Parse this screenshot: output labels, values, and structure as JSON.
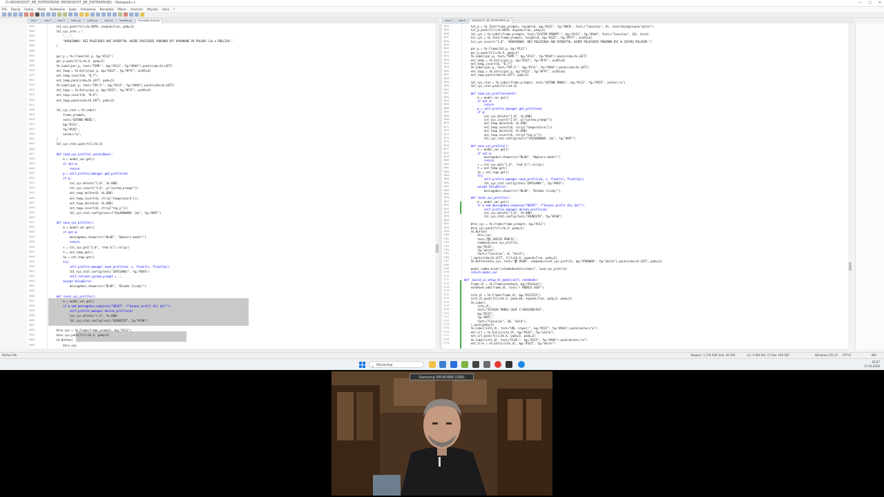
{
  "window": {
    "title": "D:\\MONOIDOT_BE_ENTERPRISE (MONOIDOT_BE_ENTERPRISE) - Notepad++",
    "controls": [
      "—",
      "□",
      "✕"
    ]
  },
  "menu": [
    "Plik",
    "Edycja",
    "Szukaj",
    "Widok",
    "Kodowanie",
    "Język",
    "Ustawienia",
    "Narzędzia",
    "Makra",
    "Uruchom",
    "Wtyczki",
    "Okna",
    "?"
  ],
  "left_tabs": [
    "new 1",
    "new 2",
    "new 3",
    "main.py",
    "config.py",
    "utils.py",
    "models.py",
    "monoidot_final.py"
  ],
  "right_tabs": [
    "new 4",
    "new 5",
    "MONOIDOT_BE_ENTERPRISE.py"
  ],
  "left_code": [
    {
      "n": "3601",
      "t": "    txt_sys.pack(fill=tk.BOTH, expand=True, pady=5)"
    },
    {
      "n": "3602",
      "t": "    lbl_sys_info = ("
    },
    {
      "n": "3603",
      "t": "        \"...\","
    },
    {
      "n": "3604",
      "t": "        \"WSKAZOWKA: BEZ POLECENIA ANI DYREKTYW, KAZDE POLECENIE POWINNO BYC WYKONANE PO POLSKU lub w ENGLISH.\""
    },
    {
      "n": "3605",
      "t": "    )"
    },
    {
      "n": "3606",
      "t": ""
    },
    {
      "n": "3607",
      "t": "    par_p = tk.Frame(lbl_p, bg=\"#111\")"
    },
    {
      "n": "3608",
      "t": "    par_p.pack(fill=tk.X, pady=5)"
    },
    {
      "n": "3609",
      "t": "    tk.Label(par_p, text=\"TEMP:\", bg=\"#111\", fg=\"#AAA\").pack(side=tk.LEFT)"
    },
    {
      "n": "3610",
      "t": "    ent_temp = tk.Entry(par_p, bg=\"#222\", fg=\"#FFF\", width=6)"
    },
    {
      "n": "3611",
      "t": "    ent_temp.insert(0, \"0.7\")"
    },
    {
      "n": "3612",
      "t": "    ent_temp.pack(side=tk.LEFT, padx=5)"
    },
    {
      "n": "3613",
      "t": "    tk.Label(par_p, text=\"TOP_P:\", bg=\"#111\", fg=\"#AAA\").pack(side=tk.LEFT)"
    },
    {
      "n": "3614",
      "t": "    ent_topp = tk.Entry(par_p, bg=\"#222\", fg=\"#FFF\", width=6)"
    },
    {
      "n": "3615",
      "t": "    ent_topp.insert(0, \"0.9\")"
    },
    {
      "n": "3616",
      "t": "    ent_topp.pack(side=tk.LEFT, padx=5)"
    },
    {
      "n": "3617",
      "t": ""
    },
    {
      "n": "3618",
      "t": "    lbl_sys_stat = tk.Label("
    },
    {
      "n": "3619",
      "t": "        frame_prompts,"
    },
    {
      "n": "3620",
      "t": "        text=\"GOTOWE MODEL\","
    },
    {
      "n": "3621",
      "t": "        bg=\"#111\","
    },
    {
      "n": "3622",
      "t": "        fg=\"#555\","
    },
    {
      "n": "3623",
      "t": "        anchor=\"w\","
    },
    {
      "n": "3624",
      "t": "    )"
    },
    {
      "n": "3625",
      "t": "    lbl_sys_stat.pack(fill=tk.X)"
    },
    {
      "n": "3626",
      "t": ""
    },
    {
      "n": "3627",
      "t": "    def load_sys_profile(_event=None):"
    },
    {
      "n": "3628",
      "t": "        m = model_var.get()"
    },
    {
      "n": "3629",
      "t": "        if not m:"
    },
    {
      "n": "3630",
      "t": "            return"
    },
    {
      "n": "3631",
      "t": "        p = self.profile_manager.get_profile(m)"
    },
    {
      "n": "3632",
      "t": "        if p:"
    },
    {
      "n": "3633",
      "t": "            txt_sys.delete(\"1.0\", tk.END)"
    },
    {
      "n": "3634",
      "t": "            txt_sys.insert(\"1.0\", p[\"system_prompt\"])"
    },
    {
      "n": "3635",
      "t": "            ent_temp.delete(0, tk.END)"
    },
    {
      "n": "3636",
      "t": "            ent_temp.insert(0, str(p[\"temperature\"]))"
    },
    {
      "n": "3637",
      "t": "            ent_topp.delete(0, tk.END)"
    },
    {
      "n": "3638",
      "t": "            ent_topp.insert(0, str(p[\"top_p\"]))"
    },
    {
      "n": "3639",
      "t": "            lbl_sys_stat.config(text=f\"ZALADOWANO: {m}\", fg=\"#0FF\")"
    },
    {
      "n": "3640",
      "t": ""
    },
    {
      "n": "3641",
      "t": "    def save_sys_profile():"
    },
    {
      "n": "3642",
      "t": "        m = model_var.get()"
    },
    {
      "n": "3643",
      "t": "        if not m:"
    },
    {
      "n": "3644",
      "t": "            messagebox.showerror(\"BLAD\", \"Wybierz model!\")"
    },
    {
      "n": "3645",
      "t": "            return"
    },
    {
      "n": "3646",
      "t": "        s = txt_sys.get(\"1.0\", \"end-1c\").strip()"
    },
    {
      "n": "3647",
      "t": "        t = ent_temp.get()"
    },
    {
      "n": "3648",
      "t": "        tp = ent_topp.get()"
    },
    {
      "n": "3649",
      "t": "        try:"
    },
    {
      "n": "3650",
      "t": "            self.profile_manager.save_profile(m, s, float(t), float(tp))"
    },
    {
      "n": "3651",
      "t": "            lbl_sys_stat.config(text=\"ZAPISANO!\", fg=\"#0F0\")"
    },
    {
      "n": "3652",
      "t": "            self.refresh_system_prompt = ..."
    },
    {
      "n": "3653",
      "t": "        except ValueError:"
    },
    {
      "n": "3654",
      "t": "            messagebox.showerror(\"BLAD\", \"Bledne liczby!\")"
    },
    {
      "n": "3655",
      "t": ""
    },
    {
      "n": "3656",
      "t": "    def reset_sys_profile():"
    },
    {
      "n": "3657",
      "t": "        m = model_var.get()"
    },
    {
      "n": "3658",
      "t": "        if m and messagebox.askyesno(\"RESET\", f\"Usunac profil dla {m}?\"):"
    },
    {
      "n": "3659",
      "t": "            self.profile_manager.delete_profile(m)"
    },
    {
      "n": "3660",
      "t": "            txt_sys.delete(\"1.0\", tk.END)"
    },
    {
      "n": "3661",
      "t": "            lbl_sys_stat.config(text=\"USUNIETO\", fg=\"#F00\")"
    },
    {
      "n": "3662",
      "t": ""
    },
    {
      "n": "3663",
      "t": "    btns_sys = tk.Frame(frame_prompts, bg=\"#111\")"
    },
    {
      "n": "3664",
      "t": "    btns_sys.pack(fill=tk.X, pady=5)"
    },
    {
      "n": "3665",
      "t": "    tk.Button("
    },
    {
      "n": "3666",
      "t": "        btns_sys,"
    }
  ],
  "right_code": [
    {
      "n": "3644",
      "t": "    txt_p = tk.Text(frame_prompts, height=6, bg=\"#222\", fg=\"#0F0\", font=(\"Consolas\", 9), insertbackground=\"white\")"
    },
    {
      "n": "3645",
      "t": "    txt_p.pack(fill=tk.BOTH, expand=True, pady=5)"
    },
    {
      "n": "3646",
      "t": "    lbl_sys = tk.Label(frame_prompts, text=\"SYSTEM PROMPT:\", bg=\"#111\", fg=\"#AAA\", font=(\"Consolas\", 10), bold)"
    },
    {
      "n": "3647",
      "t": "    txt_sys = tk.Text(frame_prompts, height=6, bg=\"#222\", fg=\"#FFF\", width=6)"
    },
    {
      "n": "3648",
      "t": "    txt_sys.insert(\"1.0\", \"WSKAZOWKA: BEZ POLECENIA ANI DYREKTYW, KAZDE POLECENIE POWINNO BYC W JEZYKU POLSKIM.\")"
    },
    {
      "n": "3649",
      "t": ""
    },
    {
      "n": "3650",
      "t": "    par_p = tk.Frame(lbl_p, bg=\"#111\")"
    },
    {
      "n": "3651",
      "t": "    par_p.pack(fill=tk.X, pady=5)"
    },
    {
      "n": "3652",
      "t": "    tk.Label(par_p, text=\"TEMP:\", bg=\"#111\", fg=\"#AAA\").pack(side=tk.LEFT)"
    },
    {
      "n": "3653",
      "t": "    ent_temp = tk.Entry(par_p, bg=\"#222\", fg=\"#FFF\", width=6)"
    },
    {
      "n": "3654",
      "t": "    ent_temp.insert(0, \"0.7\")"
    },
    {
      "n": "3655",
      "t": "    tk.Label(par_p, text=\"TOP_P:\", bg=\"#111\", fg=\"#AAA\").pack(side=tk.LEFT)"
    },
    {
      "n": "3656",
      "t": "    ent_topp = tk.Entry(par_p, bg=\"#222\", fg=\"#FFF\", width=6)"
    },
    {
      "n": "3657",
      "t": "    ent_topp.pack(side=tk.LEFT, padx=5)"
    },
    {
      "n": "3658",
      "t": ""
    },
    {
      "n": "3659",
      "t": "    lbl_sys_stat = tk.Label(frame_prompts, text=\"GOTOWE MODEL\", bg=\"#111\", fg=\"#555\", anchor=\"w\")"
    },
    {
      "n": "3660",
      "t": "    lbl_sys_stat.pack(fill=tk.X)"
    },
    {
      "n": "3661",
      "t": ""
    },
    {
      "n": "3662",
      "t": "    def load_sys_profile(event):"
    },
    {
      "n": "3663",
      "t": "        m = model_var.get()"
    },
    {
      "n": "3664",
      "t": "        if not m:"
    },
    {
      "n": "3665",
      "t": "            return"
    },
    {
      "n": "3666",
      "t": "        p = self.profile_manager.get_profile(m)"
    },
    {
      "n": "3667",
      "t": "        if p:"
    },
    {
      "n": "3668",
      "t": "            txt_sys.delete(\"1.0\", tk.END)"
    },
    {
      "n": "3669",
      "t": "            txt_sys.insert(\"1.0\", p[\"system_prompt\"])"
    },
    {
      "n": "3670",
      "t": "            ent_temp.delete(0, tk.END)"
    },
    {
      "n": "3671",
      "t": "            ent_temp.insert(0, str(p[\"temperature\"]))"
    },
    {
      "n": "3672",
      "t": "            ent_topp.delete(0, tk.END)"
    },
    {
      "n": "3673",
      "t": "            ent_topp.insert(0, str(p[\"top_p\"]))"
    },
    {
      "n": "3674",
      "t": "            lbl_sys_stat.config(text=f\"ZALADOWANO: {m}\", fg=\"#0FF\")"
    },
    {
      "n": "3675",
      "t": ""
    },
    {
      "n": "3676",
      "t": "    def save_sys_profile():"
    },
    {
      "n": "3677",
      "t": "        m = model_var.get()"
    },
    {
      "n": "3678",
      "t": "        if not m:"
    },
    {
      "n": "3679",
      "t": "            messagebox.showerror(\"BLAD\", \"Wybierz model!\")"
    },
    {
      "n": "3680",
      "t": "            return"
    },
    {
      "n": "3681",
      "t": "        s = txt_sys.get(\"1.0\", \"end-1c\").strip()"
    },
    {
      "n": "3682",
      "t": "        t = ent_temp.get()"
    },
    {
      "n": "3683",
      "t": "        tp = ent_topp.get()"
    },
    {
      "n": "3684",
      "t": "        try:"
    },
    {
      "n": "3685",
      "t": "            self.profile_manager.save_profile(m, s, float(t), float(tp))"
    },
    {
      "n": "3686",
      "t": "            lbl_sys_stat.config(text=\"ZAPISANO!\", fg=\"#0F0\")"
    },
    {
      "n": "3687",
      "t": "        except ValueError:"
    },
    {
      "n": "3688",
      "t": "            messagebox.showerror(\"BLAD\", \"Bledne liczby!\")"
    },
    {
      "n": "3689",
      "t": ""
    },
    {
      "n": "3690",
      "t": "    def reset_sys_profile():"
    },
    {
      "n": "3691",
      "t": "        m = model_var.get()"
    },
    {
      "n": "3692",
      "t": "        if m and messagebox.askyesno(\"RESET\", f\"Usunac profil dla {m}?\"):"
    },
    {
      "n": "3693",
      "t": "            self.profile_manager.delete_profile(m)"
    },
    {
      "n": "3694",
      "t": "            txt_sys.delete(\"1.0\", tk.END)"
    },
    {
      "n": "3695",
      "t": "            lbl_sys_stat.config(text=\"USUNIETO\", fg=\"#F00\")"
    },
    {
      "n": "3696",
      "t": ""
    },
    {
      "n": "3697",
      "t": "    btns_sys = tk.Frame(frame_prompts, bg=\"#111\")"
    },
    {
      "n": "3698",
      "t": "    btns_sys.pack(fill=tk.X, pady=5)"
    },
    {
      "n": "3699",
      "t": "    tk.Button("
    },
    {
      "n": "3700",
      "t": "        btns_sys,"
    },
    {
      "n": "3701",
      "t": "        text=\"💾 ZAPISZ PROFIL\","
    },
    {
      "n": "3702",
      "t": "        command=save_sys_profile,"
    },
    {
      "n": "3703",
      "t": "        bg=\"#333\","
    },
    {
      "n": "3704",
      "t": "        fg=\"white\","
    },
    {
      "n": "3705",
      "t": "        font=(\"Consolas\", 8, \"bold\"),"
    },
    {
      "n": "3706",
      "t": "    ).pack(side=tk.LEFT, fill=tk.X, expand=True, padx=2)"
    },
    {
      "n": "3707",
      "t": "    tk.Button(btns_sys, text=\"🗑 USUN\", command=reset_sys_profile, bg=\"#500000\", fg=\"white\").pack(side=tk.LEFT, padx=2)"
    },
    {
      "n": "3708",
      "t": ""
    },
    {
      "n": "3709",
      "t": "    model_combo.bind(\"<<ComboboxSelected>>\", load_sys_profile)"
    },
    {
      "n": "3710",
      "t": "    return model_var"
    },
    {
      "n": "3711",
      "t": ""
    },
    {
      "n": "3712",
      "t": "def _build_ui_setup_dl_model(self, notebook):"
    },
    {
      "n": "3713",
      "t": "    frame_dl = tk.Frame(notebook, bg=\"#1e1e1e\")"
    },
    {
      "n": "3714",
      "t": "    notebook.add(frame_dl, text=\"⬇ MODELE GGUF\")"
    },
    {
      "n": "3715",
      "t": ""
    },
    {
      "n": "3716",
      "t": "    info_dl = tk.Frame(frame_dl, bg=\"#222222\")"
    },
    {
      "n": "3717",
      "t": "    info_dl.pack(fill=tk.X, padx=10, expand=True, pady=5, padx=5)"
    },
    {
      "n": "3718",
      "t": "    tk.Label("
    },
    {
      "n": "3719",
      "t": "        info_dl,"
    },
    {
      "n": "3720",
      "t": "        text=\"SCIAGAJ MODEL GGUF Z HUGGINGFACE\","
    },
    {
      "n": "3721",
      "t": "        bg=\"#222\","
    },
    {
      "n": "3722",
      "t": "        fg=\"#0FF\","
    },
    {
      "n": "3723",
      "t": "        font=(\"Consolas\", 10, \"bold\"),"
    },
    {
      "n": "3724",
      "t": "    ).pack(pady=5)"
    },
    {
      "n": "3725",
      "t": "    tk.Label(info_dl, text=\"URL (repo):\", bg=\"#222\", fg=\"#AAA\").pack(anchor=\"w\")"
    },
    {
      "n": "3726",
      "t": "    ent_url = tk.Entry(info_dl, bg=\"#333\", fg=\"white\")"
    },
    {
      "n": "3727",
      "t": "    ent_url.pack(fill=tk.X, padx=5, pady=2)"
    },
    {
      "n": "3728",
      "t": "    tk.Label(info_dl, text=\"PLIK:\", bg=\"#222\", fg=\"#AAA\").pack(anchor=\"w\")"
    },
    {
      "n": "3729",
      "t": "    ent_file = tk.Entry(info_dl, bg=\"#333\", fg=\"white\")"
    }
  ],
  "status": {
    "left": "Python file",
    "length": "długość: 1 278 026  linie: 26 504",
    "position": "Ln: 3 664   Kol: 17   Poz: 160 287",
    "eol": "Windows (CR LF)",
    "encoding": "UTF-8",
    "mode": "INS"
  },
  "taskbar": {
    "search_placeholder": "Wyszukaj",
    "clock_time": "16:57",
    "clock_date": "17.03.2026"
  },
  "webcam": {
    "label": "Samsung SM-A546B (USB)"
  },
  "colors": {
    "keyword": "#0000ff",
    "string": "#808080",
    "builtin": "#8000ff",
    "selection": "#c9c9c9",
    "accent": "#1a73e8"
  }
}
